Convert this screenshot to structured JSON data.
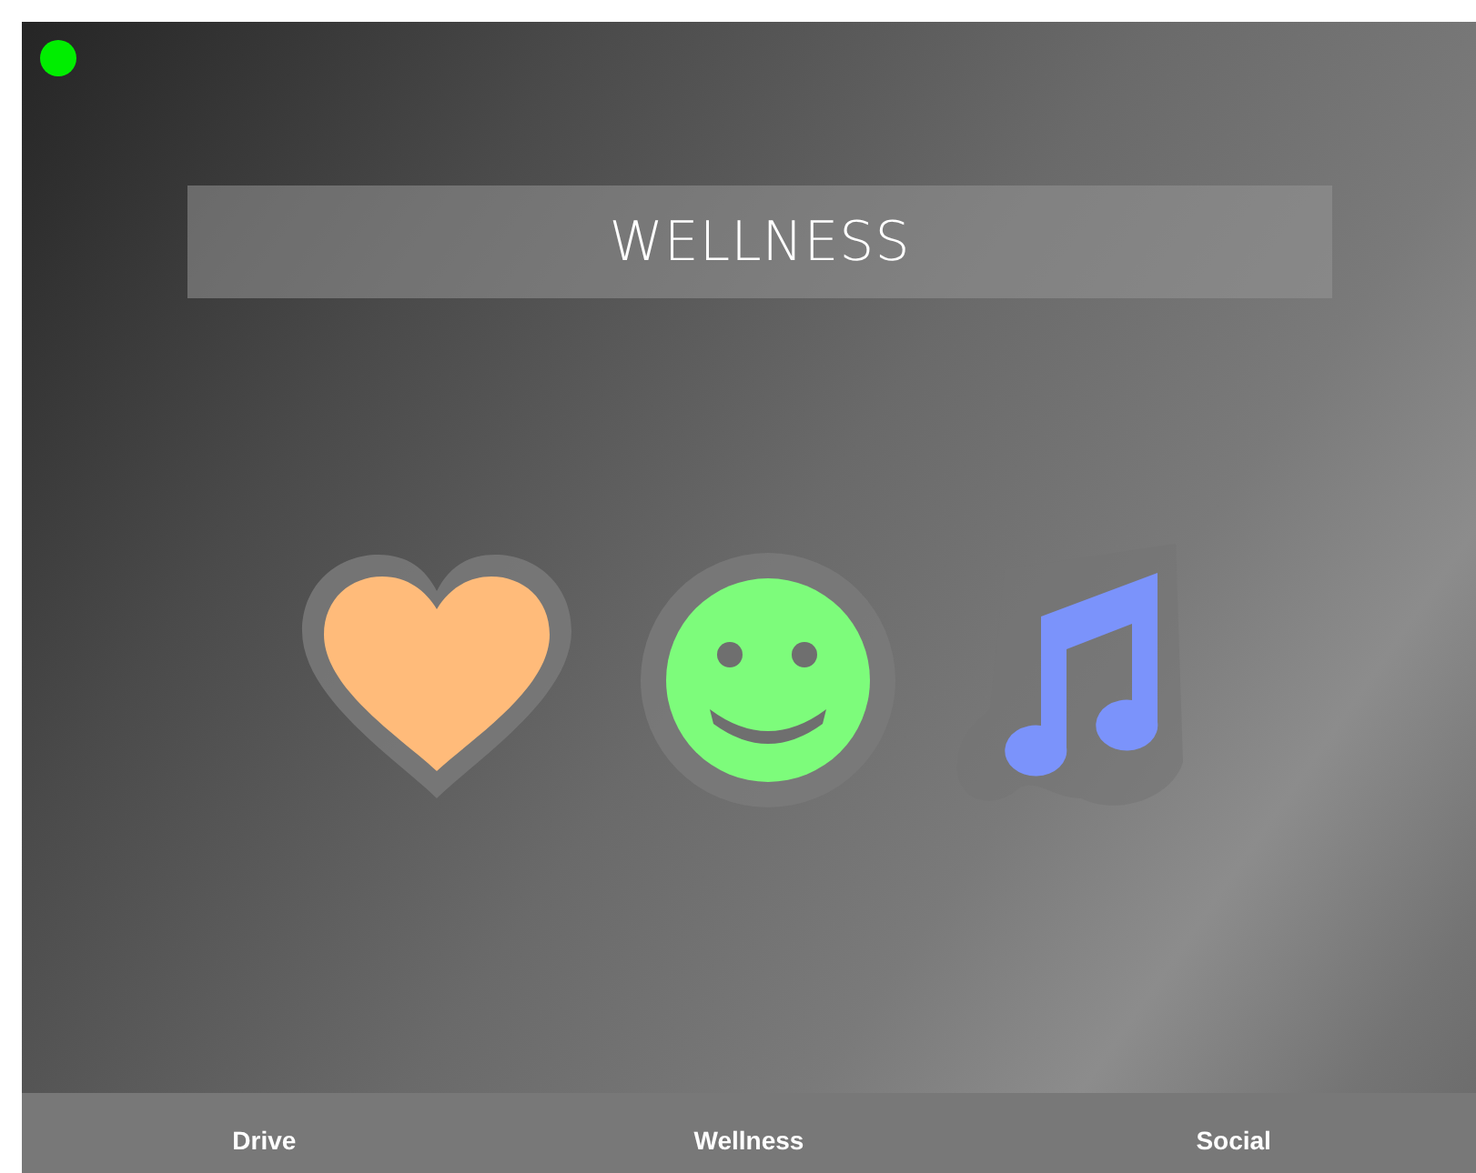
{
  "status_indicator": {
    "color": "#00ee00"
  },
  "title": "WELLNESS",
  "icons": [
    {
      "kind": "heart",
      "color": "#ffbb7a"
    },
    {
      "kind": "smiley",
      "color": "#7dfc7b"
    },
    {
      "kind": "music",
      "color": "#7b93fb"
    }
  ],
  "nav": [
    {
      "label": "Drive"
    },
    {
      "label": "Wellness"
    },
    {
      "label": "Social"
    }
  ]
}
